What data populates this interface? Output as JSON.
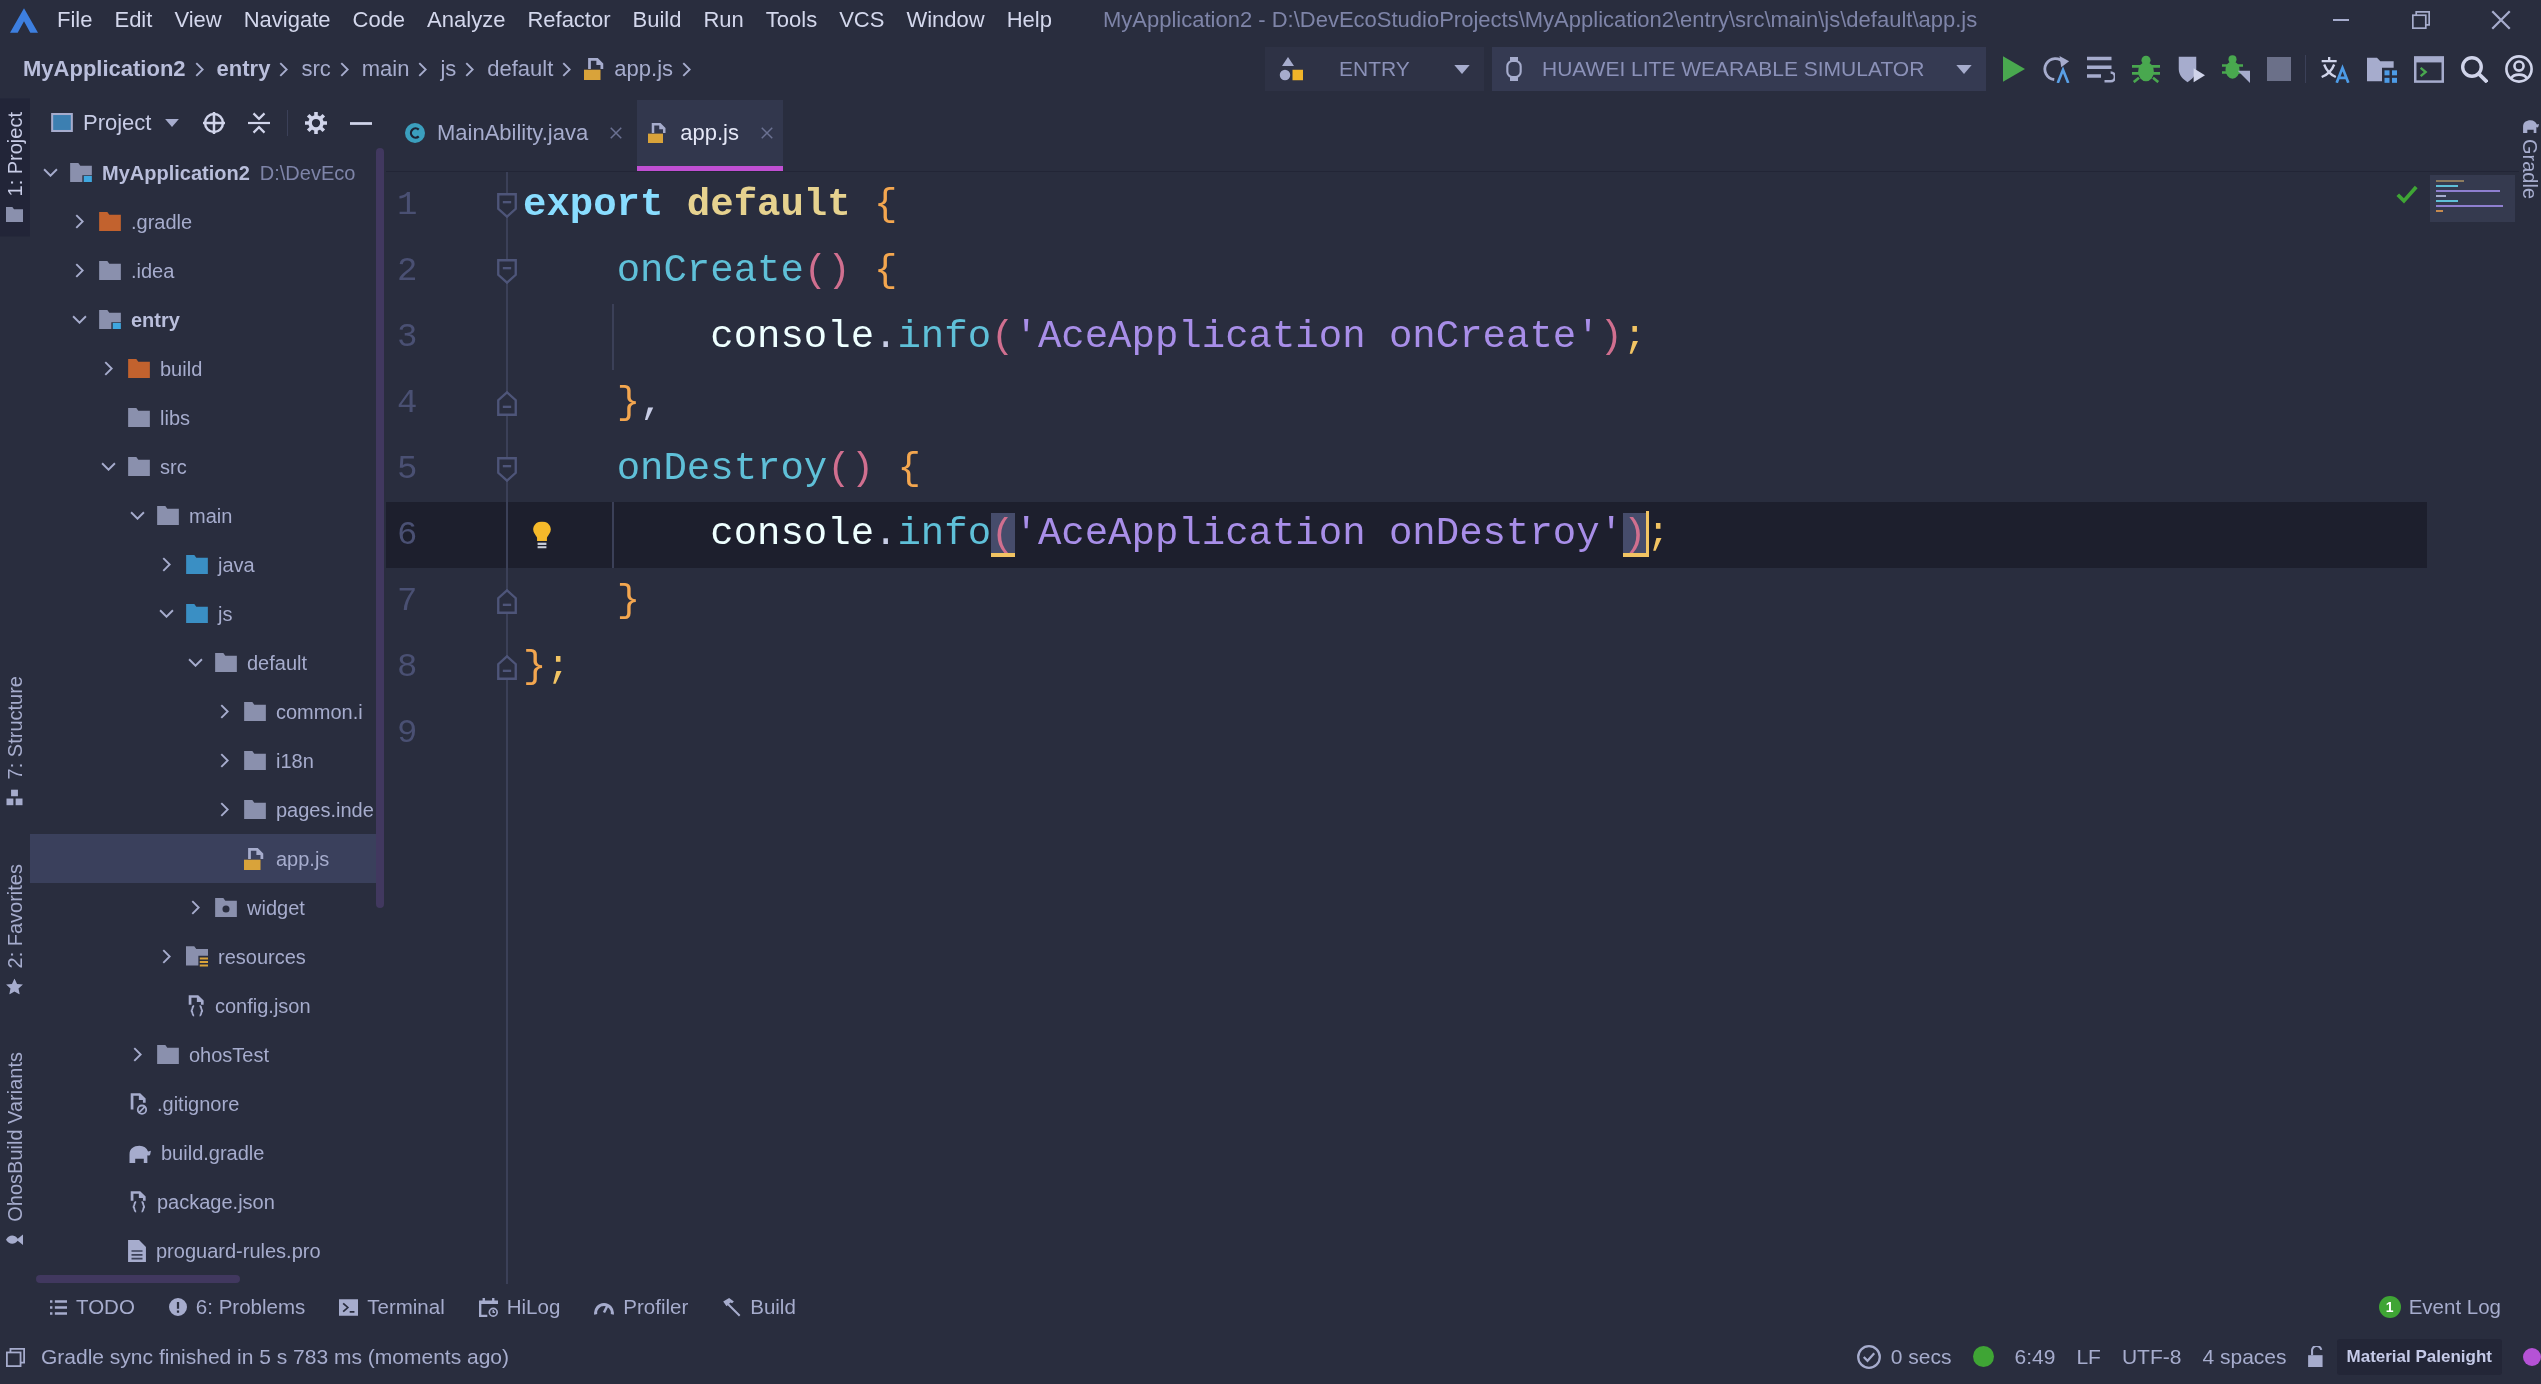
{
  "window": {
    "title": "MyApplication2 - D:\\DevEcoStudioProjects\\MyApplication2\\entry\\src\\main\\js\\default\\app.js"
  },
  "menu": [
    {
      "label": "File"
    },
    {
      "label": "Edit"
    },
    {
      "label": "View"
    },
    {
      "label": "Navigate"
    },
    {
      "label": "Code"
    },
    {
      "label": "Analyze"
    },
    {
      "label": "Refactor"
    },
    {
      "label": "Build"
    },
    {
      "label": "Run"
    },
    {
      "label": "Tools"
    },
    {
      "label": "VCS"
    },
    {
      "label": "Window"
    },
    {
      "label": "Help"
    }
  ],
  "navigation_bar": {
    "breadcrumb": [
      {
        "label": "MyApplication2",
        "kind": "module"
      },
      {
        "label": "entry",
        "kind": "module"
      },
      {
        "label": "src",
        "kind": "folder"
      },
      {
        "label": "main",
        "kind": "folder"
      },
      {
        "label": "js",
        "kind": "folder"
      },
      {
        "label": "default",
        "kind": "folder"
      },
      {
        "label": "app.js",
        "kind": "js-file"
      }
    ],
    "run_configuration": "ENTRY",
    "device": "HUAWEI LITE WEARABLE SIMULATOR"
  },
  "tool_strip_left": {
    "top": [
      {
        "label": "1: Project",
        "kind": "project",
        "selected": true
      }
    ],
    "bottom": [
      {
        "label": "7: Structure",
        "kind": "structure",
        "selected": false
      },
      {
        "label": "2: Favorites",
        "kind": "favorites",
        "selected": false
      },
      {
        "label": "OhosBuild Variants",
        "kind": "build-variants",
        "selected": false
      }
    ]
  },
  "project_panel": {
    "title": "Project",
    "tree": [
      {
        "label": "MyApplication2",
        "kind": "module",
        "hint": "D:\\DevEco",
        "expanded": true,
        "selected": false,
        "children": [
          {
            "label": ".gradle",
            "kind": "excluded-folder",
            "expanded": false,
            "selected": false
          },
          {
            "label": ".idea",
            "kind": "folder",
            "expanded": false,
            "selected": false
          },
          {
            "label": "entry",
            "kind": "module",
            "expanded": true,
            "selected": false,
            "children": [
              {
                "label": "build",
                "kind": "excluded-folder",
                "expanded": false,
                "selected": false
              },
              {
                "label": "libs",
                "kind": "folder",
                "selected": false
              },
              {
                "label": "src",
                "kind": "folder",
                "expanded": true,
                "selected": false,
                "children": [
                  {
                    "label": "main",
                    "kind": "folder",
                    "expanded": true,
                    "selected": false,
                    "children": [
                      {
                        "label": "java",
                        "kind": "source-folder",
                        "expanded": false,
                        "selected": false
                      },
                      {
                        "label": "js",
                        "kind": "source-folder",
                        "expanded": true,
                        "selected": false,
                        "children": [
                          {
                            "label": "default",
                            "kind": "folder",
                            "expanded": true,
                            "selected": false,
                            "children": [
                              {
                                "label": "common.i",
                                "kind": "folder",
                                "expanded": false,
                                "selected": false
                              },
                              {
                                "label": "i18n",
                                "kind": "folder",
                                "expanded": false,
                                "selected": false
                              },
                              {
                                "label": "pages.inde",
                                "kind": "folder",
                                "expanded": false,
                                "selected": false
                              },
                              {
                                "label": "app.js",
                                "kind": "js-file",
                                "selected": true
                              }
                            ]
                          },
                          {
                            "label": "widget",
                            "kind": "widget-folder",
                            "expanded": false,
                            "selected": false
                          }
                        ]
                      },
                      {
                        "label": "resources",
                        "kind": "resources-folder",
                        "expanded": false,
                        "selected": false
                      },
                      {
                        "label": "config.json",
                        "kind": "json-file",
                        "selected": false
                      }
                    ]
                  },
                  {
                    "label": "ohosTest",
                    "kind": "folder",
                    "expanded": false,
                    "selected": false
                  }
                ]
              },
              {
                "label": ".gitignore",
                "kind": "ignore-file",
                "selected": false
              },
              {
                "label": "build.gradle",
                "kind": "gradle-file",
                "selected": false
              },
              {
                "label": "package.json",
                "kind": "json-file",
                "selected": false
              },
              {
                "label": "proguard-rules.pro",
                "kind": "text-file",
                "selected": false
              }
            ]
          }
        ]
      }
    ]
  },
  "editor": {
    "tabs": [
      {
        "label": "MainAbility.java",
        "kind": "class",
        "selected": false
      },
      {
        "label": "app.js",
        "kind": "js",
        "selected": true
      }
    ],
    "lines": [
      {
        "number": "1",
        "text": "export default {",
        "kind": "fold-start",
        "guide": false,
        "bulb": false
      },
      {
        "number": "2",
        "text": "    onCreate() {",
        "kind": "fold-start",
        "guide": false,
        "bulb": false
      },
      {
        "number": "3",
        "text": "        console.info('AceApplication onCreate');",
        "kind": "plain",
        "guide": true,
        "bulb": false
      },
      {
        "number": "4",
        "text": "    },",
        "kind": "fold-end",
        "guide": false,
        "bulb": false
      },
      {
        "number": "5",
        "text": "    onDestroy() {",
        "kind": "fold-start",
        "guide": false,
        "bulb": false
      },
      {
        "number": "6",
        "text": "        console.info('AceApplication onDestroy');",
        "kind": "plain",
        "guide": true,
        "bulb": true
      },
      {
        "number": "7",
        "text": "    }",
        "kind": "fold-end",
        "guide": false,
        "bulb": false
      },
      {
        "number": "8",
        "text": "};",
        "kind": "fold-end",
        "guide": false,
        "bulb": false
      },
      {
        "number": "9",
        "kind": "plain",
        "guide": false,
        "bulb": false
      }
    ]
  },
  "tool_strip_right": [
    {
      "label": "Gradle"
    }
  ],
  "bottom_tools": [
    {
      "label": "TODO",
      "kind": "todo"
    },
    {
      "label": "6: Problems",
      "kind": "problems"
    },
    {
      "label": "Terminal",
      "kind": "terminal"
    },
    {
      "label": "HiLog",
      "kind": "hilog"
    },
    {
      "label": "Profiler",
      "kind": "profiler"
    },
    {
      "label": "Build",
      "kind": "build"
    }
  ],
  "event_log": {
    "label": "Event Log",
    "count": "1"
  },
  "status_bar": {
    "message": "Gradle sync finished in 5 s 783 ms (moments ago)",
    "elapsed": "0 secs",
    "position": "6:49",
    "line_separator": "LF",
    "encoding": "UTF-8",
    "indent": "4 spaces",
    "theme": "Material Palenight"
  }
}
